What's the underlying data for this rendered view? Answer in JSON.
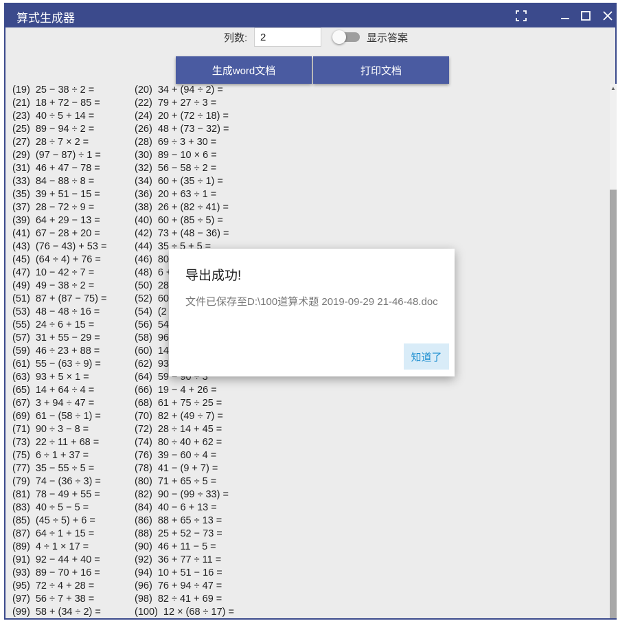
{
  "window": {
    "title": "算式生成器"
  },
  "controls": {
    "columns_label": "列数:",
    "columns_value": "2",
    "show_answers_label": "显示答案",
    "show_answers_on": false,
    "generate_button": "生成word文档",
    "print_button": "打印文档"
  },
  "problems": [
    [
      "(19)  25 − 38 ÷ 2 =",
      "(20)  34 + (94 ÷ 2) ="
    ],
    [
      "(21)  18 + 72 − 85 =",
      "(22)  79 + 27 ÷ 3 ="
    ],
    [
      "(23)  40 ÷ 5 + 14 =",
      "(24)  20 + (72 ÷ 18) ="
    ],
    [
      "(25)  89 − 94 ÷ 2 =",
      "(26)  48 + (73 − 32) ="
    ],
    [
      "(27)  28 ÷ 7 × 2 =",
      "(28)  69 ÷ 3 + 30 ="
    ],
    [
      "(29)  (97 − 87) ÷ 1 =",
      "(30)  89 − 10 × 6 ="
    ],
    [
      "(31)  46 + 47 − 78 =",
      "(32)  56 − 58 ÷ 2 ="
    ],
    [
      "(33)  84 − 88 ÷ 8 =",
      "(34)  60 + (35 ÷ 1) ="
    ],
    [
      "(35)  39 + 51 − 15 =",
      "(36)  20 + 63 ÷ 1 ="
    ],
    [
      "(37)  28 − 72 ÷ 9 =",
      "(38)  26 + (82 ÷ 41) ="
    ],
    [
      "(39)  64 + 29 − 13 =",
      "(40)  60 + (85 ÷ 5) ="
    ],
    [
      "(41)  67 − 28 + 20 =",
      "(42)  73 + (48 − 36) ="
    ],
    [
      "(43)  (76 − 43) + 53 =",
      "(44)  35 ÷ 5 + 5 ="
    ],
    [
      "(45)  (64 ÷ 4) + 76 =",
      "(46)  80"
    ],
    [
      "(47)  10 − 42 ÷ 7 =",
      "(48)  6 +"
    ],
    [
      "(49)  49 − 38 ÷ 2 =",
      "(50)  28"
    ],
    [
      "(51)  87 + (87 − 75) =",
      "(52)  60"
    ],
    [
      "(53)  48 − 48 ÷ 16 =",
      "(54)  (2"
    ],
    [
      "(55)  24 ÷ 6 + 15 =",
      "(56)  54"
    ],
    [
      "(57)  31 + 55 − 29 =",
      "(58)  96"
    ],
    [
      "(59)  46 ÷ 23 + 88 =",
      "(60)  14"
    ],
    [
      "(61)  55 − (63 ÷ 9) =",
      "(62)  93"
    ],
    [
      "(63)  93 + 5 × 1 =",
      "(64)  59 − 90 ÷ 3"
    ],
    [
      "(65)  14 + 64 ÷ 4 =",
      "(66)  19 − 4 + 26 ="
    ],
    [
      "(67)  3 + 94 ÷ 47 =",
      "(68)  61 + 75 ÷ 25 ="
    ],
    [
      "(69)  61 − (58 ÷ 1) =",
      "(70)  82 + (49 ÷ 7) ="
    ],
    [
      "(71)  90 ÷ 3 − 8 =",
      "(72)  28 ÷ 14 + 45 ="
    ],
    [
      "(73)  22 ÷ 11 + 68 =",
      "(74)  80 ÷ 40 + 62 ="
    ],
    [
      "(75)  6 ÷ 1 + 37 =",
      "(76)  39 − 60 ÷ 4 ="
    ],
    [
      "(77)  35 − 55 ÷ 5 =",
      "(78)  41 − (9 + 7) ="
    ],
    [
      "(79)  74 − (36 ÷ 3) =",
      "(80)  71 + 65 ÷ 5 ="
    ],
    [
      "(81)  78 − 49 + 55 =",
      "(82)  90 − (99 ÷ 33) ="
    ],
    [
      "(83)  40 ÷ 5 − 5 =",
      "(84)  40 − 6 + 13 ="
    ],
    [
      "(85)  (45 ÷ 5) + 6 =",
      "(86)  88 + 65 ÷ 13 ="
    ],
    [
      "(87)  64 ÷ 1 + 15 =",
      "(88)  25 + 52 − 73 ="
    ],
    [
      "(89)  4 ÷ 1 × 17 =",
      "(90)  46 + 11 − 5 ="
    ],
    [
      "(91)  92 − 44 + 40 =",
      "(92)  36 + 77 ÷ 11 ="
    ],
    [
      "(93)  89 − 70 + 16 =",
      "(94)  10 + 51 − 16 ="
    ],
    [
      "(95)  72 ÷ 4 + 28 =",
      "(96)  76 + 94 ÷ 47 ="
    ],
    [
      "(97)  56 ÷ 7 + 38 =",
      "(98)  82 ÷ 41 + 69 ="
    ],
    [
      "(99)  58 + (34 ÷ 2) =",
      "(100)  12 × (68 ÷ 17) ="
    ]
  ],
  "dialog": {
    "title": "导出成功!",
    "message": "文件已保存至D:\\100道算术题 2019-09-29 21-46-48.doc",
    "ok_button": "知道了"
  },
  "colors": {
    "titlebar": "#3b4a8c",
    "button": "#4a5ba1",
    "dialog_button_bg": "#d9ecf8",
    "dialog_button_text": "#1f8fd0"
  },
  "icons": [
    "fullscreen-icon",
    "minimize-icon",
    "maximize-icon",
    "close-icon"
  ]
}
